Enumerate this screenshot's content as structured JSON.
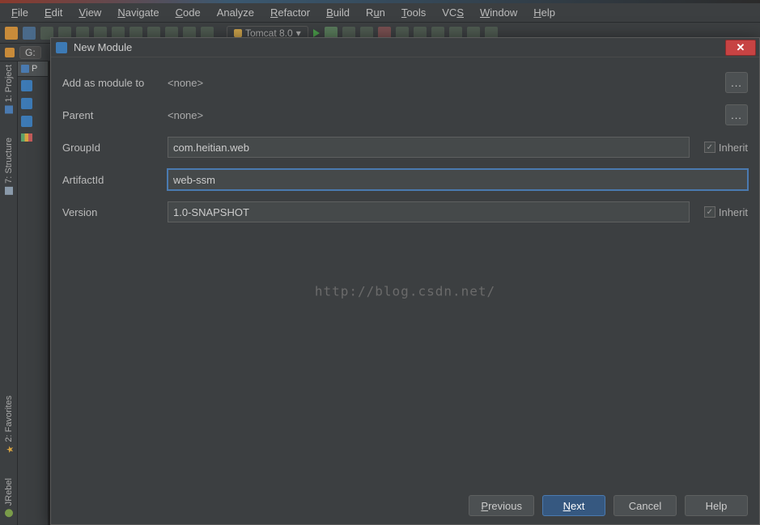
{
  "menubar": {
    "file": "File",
    "edit": "Edit",
    "view": "View",
    "navigate": "Navigate",
    "code": "Code",
    "analyze": "Analyze",
    "refactor": "Refactor",
    "build": "Build",
    "run": "Run",
    "tools": "Tools",
    "vcs": "VCS",
    "window": "Window",
    "help": "Help"
  },
  "toolbar": {
    "runconfig": "Tomcat 8.0"
  },
  "pathbar": {
    "root": "G:"
  },
  "projectpanel": {
    "tab": "P"
  },
  "sidetabs": {
    "project": "1: Project",
    "structure": "7: Structure",
    "favorites": "2: Favorites",
    "jrebel": "JRebel"
  },
  "dialog": {
    "title": "New Module",
    "add_as_module_to_label": "Add as module to",
    "add_as_module_to_value": "<none>",
    "parent_label": "Parent",
    "parent_value": "<none>",
    "groupid_label": "GroupId",
    "groupid_value": "com.heitian.web",
    "artifactid_label": "ArtifactId",
    "artifactid_value": "web-ssm",
    "version_label": "Version",
    "version_value": "1.0-SNAPSHOT",
    "inherit_label": "Inherit",
    "browse": "...",
    "buttons": {
      "previous": "Previous",
      "next": "Next",
      "cancel": "Cancel",
      "help": "Help"
    }
  },
  "watermark": "http://blog.csdn.net/"
}
